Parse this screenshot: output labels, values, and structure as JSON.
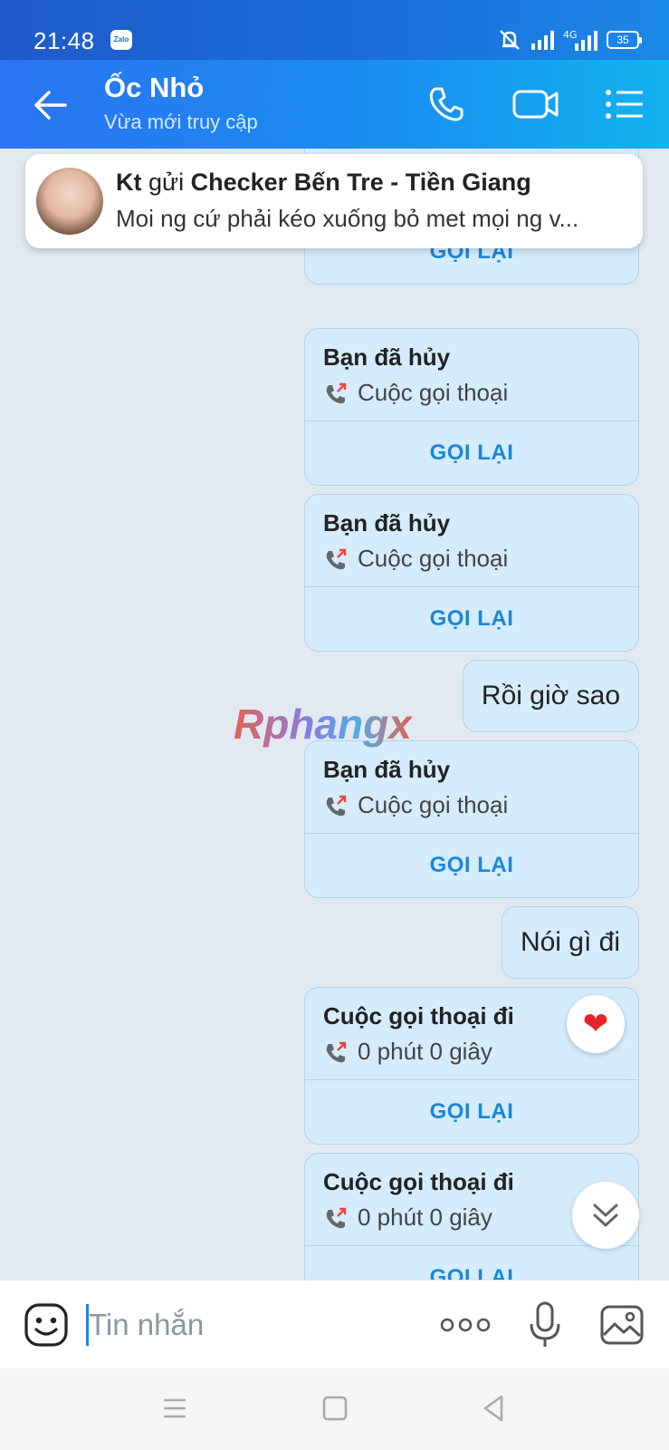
{
  "status_bar": {
    "time": "21:48",
    "app_badge": "Zalo",
    "network": "4G",
    "battery": "35"
  },
  "header": {
    "title": "Ốc Nhỏ",
    "subtitle": "Vừa mới truy cập"
  },
  "notification": {
    "sender": "Kt",
    "verb": "gửi",
    "group": "Checker Bến Tre - Tiền Giang",
    "preview": "Moi ng cứ phải kéo xuống bỏ met mọi ng v..."
  },
  "messages": [
    {
      "kind": "call_partial",
      "button": "GỌI LẠI"
    },
    {
      "kind": "call",
      "title": "Bạn đã hủy",
      "detail": "Cuộc gọi thoại",
      "button": "GỌI LẠI"
    },
    {
      "kind": "call",
      "title": "Bạn đã hủy",
      "detail": "Cuộc gọi thoại",
      "button": "GỌI LẠI"
    },
    {
      "kind": "text",
      "text": "Rồi giờ sao"
    },
    {
      "kind": "call",
      "title": "Bạn đã hủy",
      "detail": "Cuộc gọi thoại",
      "button": "GỌI LẠI"
    },
    {
      "kind": "text",
      "text": "Nói gì đi"
    },
    {
      "kind": "call",
      "title": "Cuộc gọi thoại đi",
      "detail": "0 phút 0 giây",
      "button": "GỌI LẠI",
      "reaction": "❤"
    },
    {
      "kind": "call",
      "title": "Cuộc gọi thoại đi",
      "detail": "0 phút 0 giây",
      "button": "GỌI LẠI"
    }
  ],
  "watermark": "Rphangx",
  "input": {
    "placeholder": "Tin nhắn"
  },
  "colors": {
    "header_start": "#2b73f1",
    "header_end": "#12b2ef",
    "bubble": "#d5ecfd",
    "accent": "#1a86d8",
    "missed_arrow": "#e8463a"
  }
}
